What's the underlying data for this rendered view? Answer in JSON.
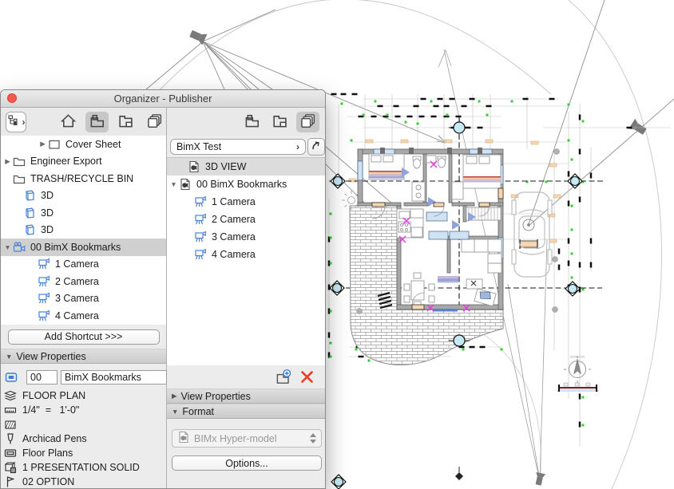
{
  "window": {
    "title": "Organizer - Publisher"
  },
  "left": {
    "toolbar": {
      "chooser_chevron": "›",
      "tabs": [
        {
          "name": "project-map",
          "icon": "house",
          "selected": false
        },
        {
          "name": "view-map",
          "icon": "view-map",
          "selected": true
        },
        {
          "name": "layout-book",
          "icon": "layout-book",
          "selected": false
        },
        {
          "name": "publisher-sets",
          "icon": "publisher-sets",
          "selected": false
        }
      ]
    },
    "tree": [
      {
        "label": "Cover Sheet",
        "icon": "layout-sheet",
        "depth": 2,
        "expander": "collapsed",
        "selected": false
      },
      {
        "label": "Engineer Export",
        "icon": "folder",
        "depth": 0,
        "expander": "collapsed",
        "selected": false
      },
      {
        "label": "TRASH/RECYCLE BIN",
        "icon": "folder",
        "depth": 0,
        "expander": "none",
        "selected": false
      },
      {
        "label": "3D",
        "icon": "view-3d",
        "depth": 1,
        "expander": "none",
        "selected": false
      },
      {
        "label": "3D",
        "icon": "view-3d",
        "depth": 1,
        "expander": "none",
        "selected": false
      },
      {
        "label": "3D",
        "icon": "view-3d",
        "depth": 1,
        "expander": "none",
        "selected": false
      },
      {
        "label": "00 BimX Bookmarks",
        "icon": "movie-camera",
        "depth": 0,
        "expander": "expanded",
        "selected": true
      },
      {
        "label": "1 Camera",
        "icon": "camera",
        "depth": 2,
        "expander": "none",
        "selected": false
      },
      {
        "label": "2 Camera",
        "icon": "camera",
        "depth": 2,
        "expander": "none",
        "selected": false
      },
      {
        "label": "3 Camera",
        "icon": "camera",
        "depth": 2,
        "expander": "none",
        "selected": false
      },
      {
        "label": "4 Camera",
        "icon": "camera",
        "depth": 2,
        "expander": "none",
        "selected": false
      }
    ],
    "add_shortcut": "Add Shortcut >>>",
    "view_properties": {
      "header": "View Properties",
      "id_value": "00",
      "name_value": "BimX Bookmarks",
      "rows": [
        {
          "icon": "layers",
          "text": "FLOOR PLAN"
        },
        {
          "icon": "ruler",
          "text": "1/4\"  =   1'-0\""
        },
        {
          "icon": "hatch",
          "text": ""
        },
        {
          "icon": "pen",
          "text": "Archicad Pens"
        },
        {
          "icon": "model-view",
          "text": "Floor Plans"
        },
        {
          "icon": "renovation",
          "text": "1 PRESENTATION SOLID"
        },
        {
          "icon": "option-flag",
          "text": "02 OPTION"
        }
      ]
    }
  },
  "right": {
    "toolbar": {
      "tabs": [
        {
          "name": "view-map",
          "icon": "view-map",
          "selected": false
        },
        {
          "name": "layout-book",
          "icon": "layout-book",
          "selected": false
        },
        {
          "name": "publisher-sets",
          "icon": "publisher-sets",
          "selected": true
        }
      ]
    },
    "set_selector": {
      "name": "BimX Test",
      "chevron": "›"
    },
    "list": [
      {
        "label": "3D VIEW",
        "icon": "bimx-doc",
        "depth": 1,
        "expander": "none",
        "selected": true
      },
      {
        "label": "00 BimX Bookmarks",
        "icon": "bimx-doc",
        "depth": 0,
        "expander": "expanded",
        "selected": false
      },
      {
        "label": "1 Camera",
        "icon": "camera",
        "depth": 2,
        "expander": "none",
        "selected": false
      },
      {
        "label": "2 Camera",
        "icon": "camera",
        "depth": 2,
        "expander": "none",
        "selected": false
      },
      {
        "label": "3 Camera",
        "icon": "camera",
        "depth": 2,
        "expander": "none",
        "selected": false
      },
      {
        "label": "4 Camera",
        "icon": "camera",
        "depth": 2,
        "expander": "none",
        "selected": false
      }
    ],
    "sections": {
      "view_properties": "View Properties",
      "format": "Format"
    },
    "format_value": "BIMx Hyper-model",
    "options_button": "Options..."
  }
}
